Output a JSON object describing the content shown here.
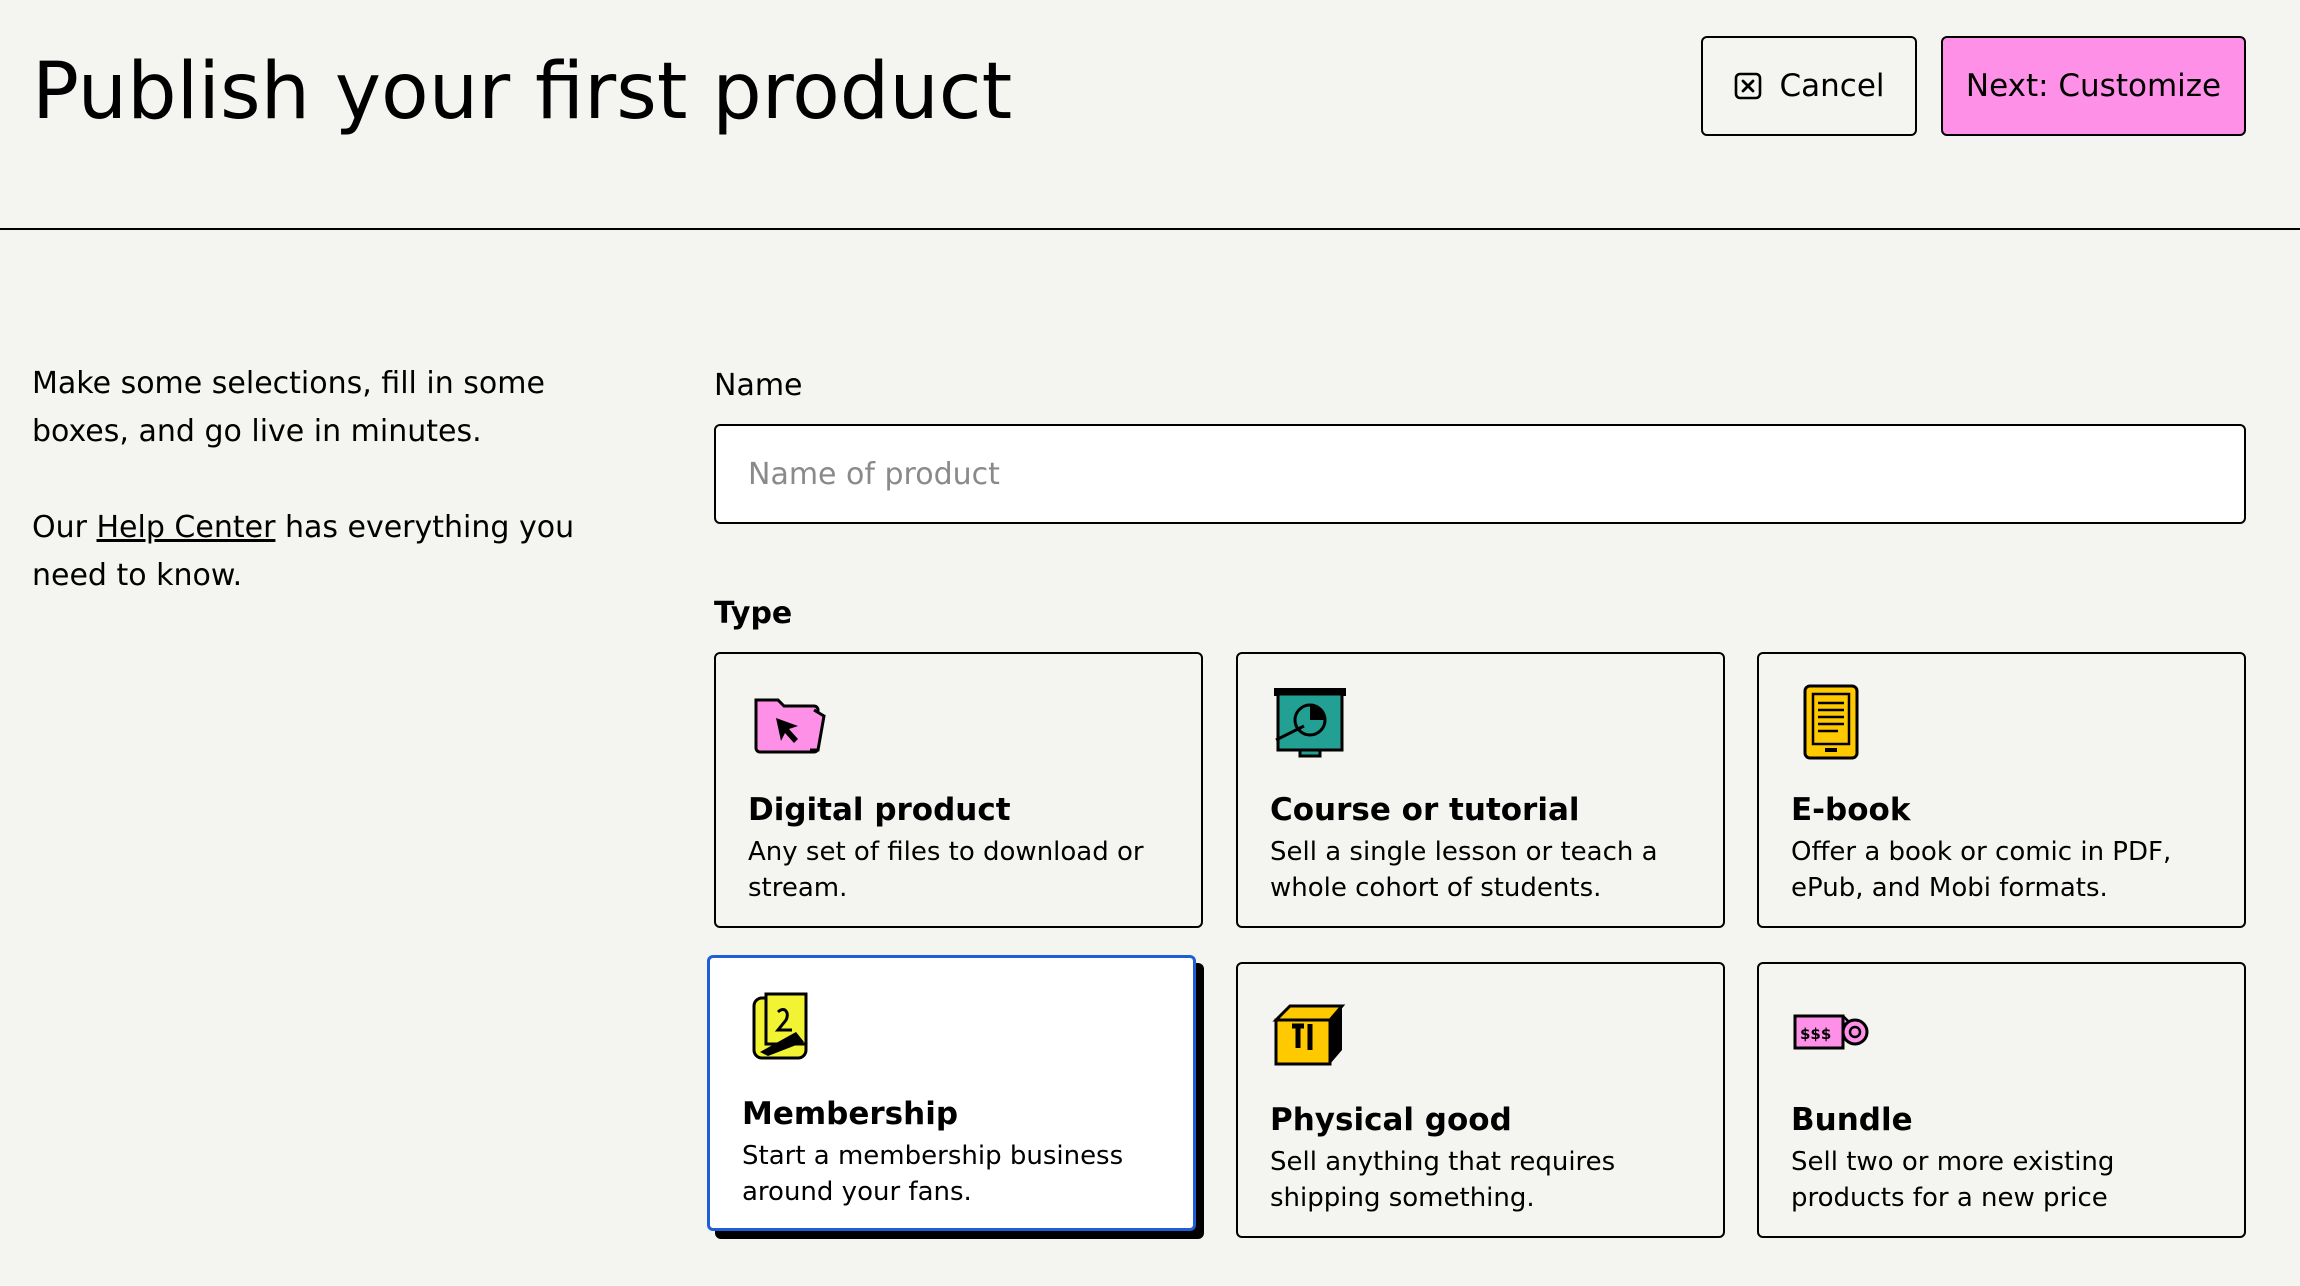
{
  "header": {
    "title": "Publish your first product",
    "cancel_label": "Cancel",
    "next_label": "Next: Customize"
  },
  "intro": {
    "line1": "Make some selections, fill in some boxes, and go live in minutes.",
    "help_prefix": "Our ",
    "help_link": "Help Center",
    "help_suffix": " has everything you need to know."
  },
  "form": {
    "name_label": "Name",
    "name_value": "",
    "name_placeholder": "Name of product",
    "type_label": "Type"
  },
  "types": [
    {
      "title": "Digital product",
      "description": "Any set of files to download or stream.",
      "icon": "folder-cursor-icon",
      "selected": false
    },
    {
      "title": "Course or tutorial",
      "description": "Sell a single lesson or teach a whole cohort of students.",
      "icon": "presentation-board-icon",
      "selected": false
    },
    {
      "title": "E-book",
      "description": "Offer a book or comic in PDF, ePub, and Mobi formats.",
      "icon": "ereader-icon",
      "selected": false
    },
    {
      "title": "Membership",
      "description": "Start a membership business around your fans.",
      "icon": "membership-card-icon",
      "selected": true
    },
    {
      "title": "Physical good",
      "description": "Sell anything that requires shipping something.",
      "icon": "package-box-icon",
      "selected": false
    },
    {
      "title": "Bundle",
      "description": "Sell two or more existing products for a new price",
      "icon": "price-tag-icon",
      "selected": false
    }
  ],
  "colors": {
    "background": "#f4f4f0",
    "accent_pink": "#ff90e8",
    "selected_border": "#1f5fd6",
    "teal": "#23a094",
    "yellow": "#ffc900",
    "lime": "#f1f333"
  }
}
